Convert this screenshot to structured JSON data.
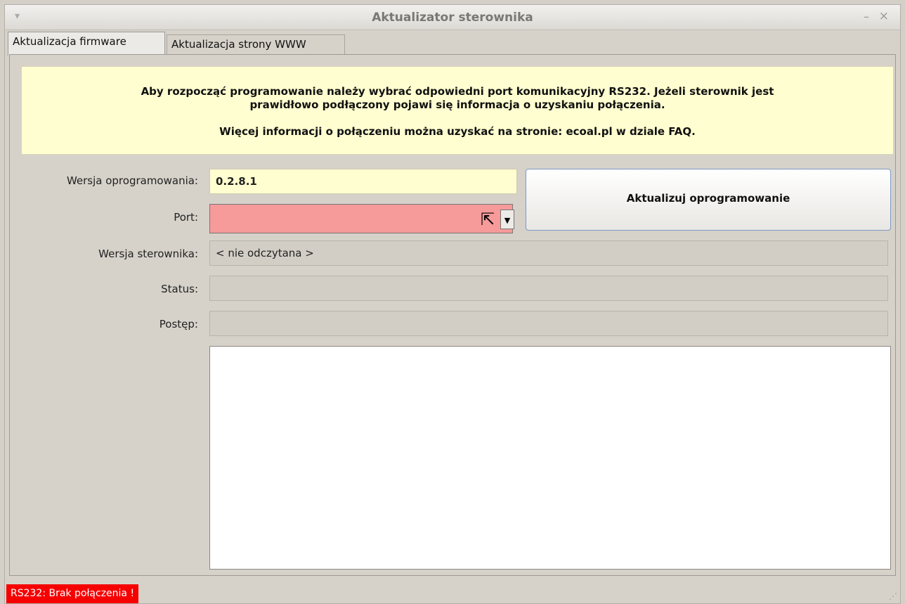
{
  "window": {
    "title": "Aktualizator sterownika"
  },
  "tabs": [
    {
      "label": "Aktualizacja firmware",
      "active": true
    },
    {
      "label": "Aktualizacja strony WWW",
      "active": false
    }
  ],
  "info": {
    "line1": "Aby rozpocząć programowanie należy wybrać odpowiedni port komunikacyjny RS232. Jeżeli sterownik jest",
    "line2": "prawidłowo podłączony pojawi się informacja o uzyskaniu połączenia.",
    "line3": "Więcej informacji o połączeniu można uzyskać na stronie: ecoal.pl w dziale FAQ."
  },
  "form": {
    "firmware_label": "Wersja oprogramowania:",
    "firmware_value": "0.2.8.1",
    "port_label": "Port:",
    "port_value": "",
    "controller_label": "Wersja sterownika:",
    "controller_value": "< nie odczytana >",
    "status_label": "Status:",
    "status_value": "",
    "progress_label": "Postęp:",
    "progress_value": 0
  },
  "buttons": {
    "update_label": "Aktualizuj oprogramowanie"
  },
  "statusbar": {
    "message": "RS232: Brak połączenia !"
  },
  "colors": {
    "info_bg": "#fffed0",
    "port_error_bg": "#f69a9a",
    "status_error_bg": "#f60000"
  },
  "icons": {
    "window_menu": "down-arrow",
    "minimize": "minus",
    "close": "x",
    "dropdown": "chevron-down",
    "cursor": "pointer",
    "resize_grip": "dots"
  }
}
